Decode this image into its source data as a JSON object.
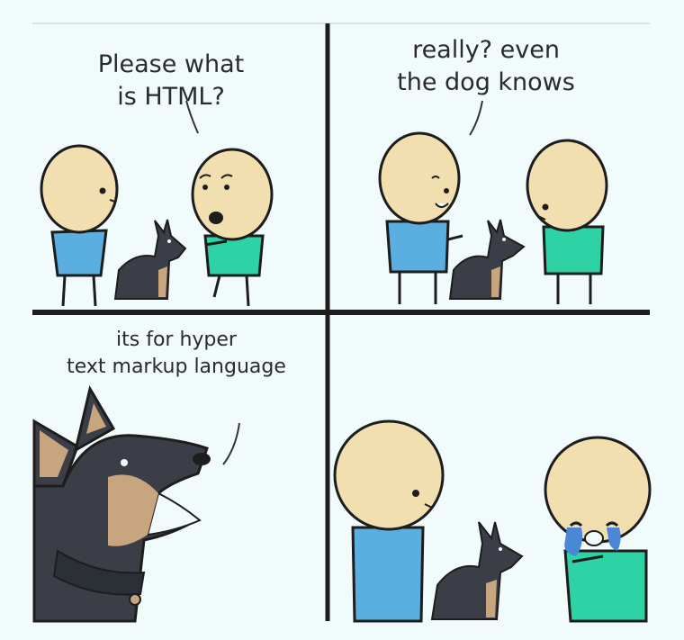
{
  "panels": [
    {
      "id": "panel-1",
      "speech": [
        "Please what",
        "is HTML?"
      ]
    },
    {
      "id": "panel-2",
      "speech": [
        "really? even",
        "the dog knows"
      ]
    },
    {
      "id": "panel-3",
      "speech": [
        "its for hyper",
        "text markup language"
      ]
    },
    {
      "id": "panel-4",
      "speech": []
    }
  ],
  "colors": {
    "background": "#f2fbfc",
    "border": "#1d1d1d",
    "skin": "#f2dfb0",
    "blue_shirt": "#5aaee0",
    "green_shirt": "#2ed3a5",
    "dog_dark": "#3b3e46",
    "dog_tan": "#c7a57f",
    "tear": "#4a88d6"
  }
}
